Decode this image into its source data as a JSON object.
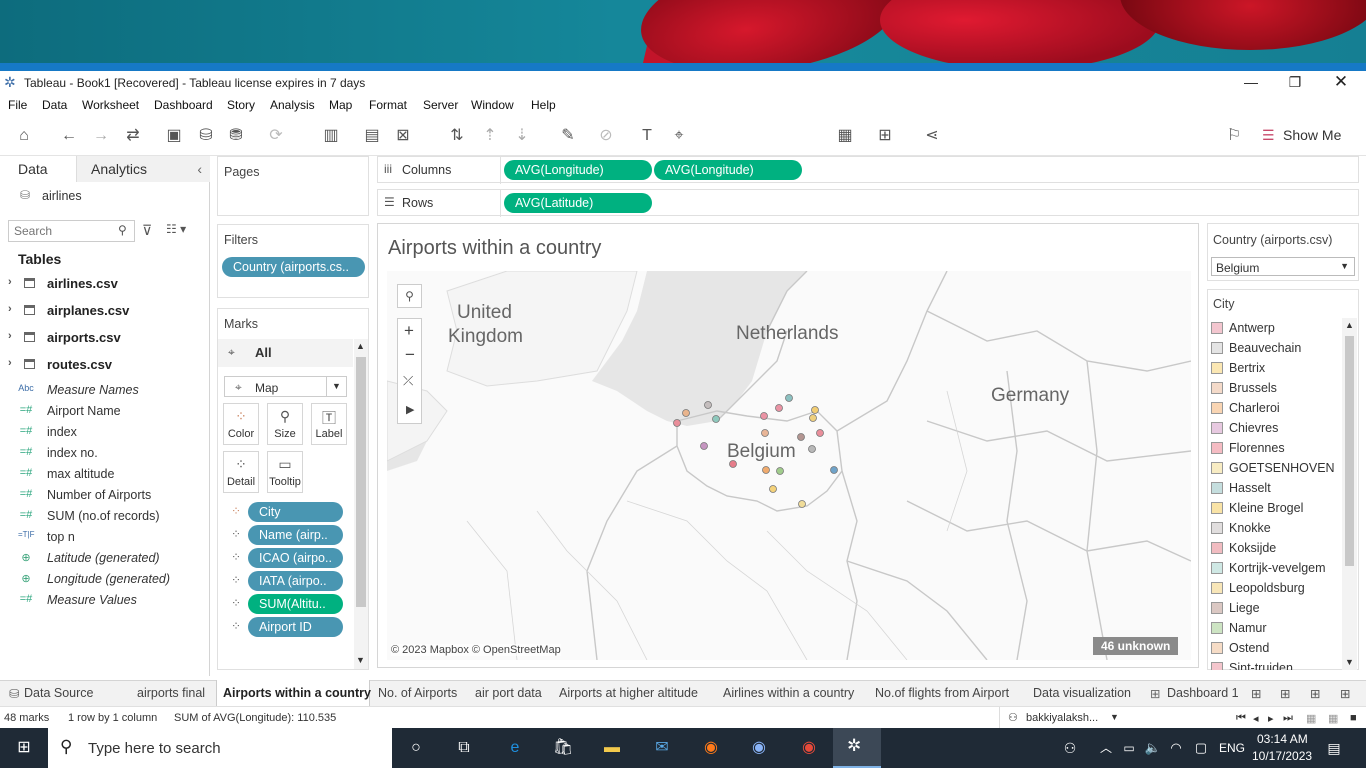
{
  "window": {
    "title": "Tableau - Book1 [Recovered] - Tableau license expires in 7 days"
  },
  "menu": [
    "File",
    "Data",
    "Worksheet",
    "Dashboard",
    "Story",
    "Analysis",
    "Map",
    "Format",
    "Server",
    "Window",
    "Help"
  ],
  "toolbar": {
    "show_me": "Show Me"
  },
  "left_panel": {
    "tab_data": "Data",
    "tab_analytics": "Analytics",
    "datasource": "airlines",
    "search_placeholder": "Search",
    "tables_heading": "Tables",
    "tables": [
      "airlines.csv",
      "airplanes.csv",
      "airports.csv",
      "routes.csv"
    ],
    "fields": [
      {
        "icon": "Abc",
        "label": "Measure Names",
        "italic": true
      },
      {
        "icon": "#",
        "label": "Airport Name",
        "italic": false
      },
      {
        "icon": "#",
        "label": "index",
        "italic": false
      },
      {
        "icon": "#",
        "label": "index no.",
        "italic": false
      },
      {
        "icon": "#",
        "label": "max altitude",
        "italic": false
      },
      {
        "icon": "#",
        "label": "Number of Airports",
        "italic": false
      },
      {
        "icon": "#",
        "label": "SUM (no.of records)",
        "italic": false
      },
      {
        "icon": "T|F",
        "label": "top n",
        "italic": false
      },
      {
        "icon": "globe",
        "label": "Latitude (generated)",
        "italic": true
      },
      {
        "icon": "globe",
        "label": "Longitude (generated)",
        "italic": true
      },
      {
        "icon": "#",
        "label": "Measure Values",
        "italic": true
      }
    ]
  },
  "pages": {
    "title": "Pages"
  },
  "filters": {
    "title": "Filters",
    "pills": [
      "Country (airports.cs.."
    ]
  },
  "marks": {
    "title": "Marks",
    "all_label": "All",
    "mark_type": "Map",
    "cards": [
      "Color",
      "Size",
      "Label",
      "Detail",
      "Tooltip"
    ],
    "pills": [
      {
        "icon": "color",
        "label": "City",
        "color": "blue"
      },
      {
        "icon": "detail",
        "label": "Name (airp..",
        "color": "blue"
      },
      {
        "icon": "detail",
        "label": "ICAO (airpo..",
        "color": "blue"
      },
      {
        "icon": "detail",
        "label": "IATA (airpo..",
        "color": "blue"
      },
      {
        "icon": "detail",
        "label": "SUM(Altitu..",
        "color": "green"
      },
      {
        "icon": "detail",
        "label": "Airport ID",
        "color": "blue"
      }
    ]
  },
  "shelves": {
    "columns_label": "Columns",
    "columns": [
      "AVG(Longitude)",
      "AVG(Longitude)"
    ],
    "rows_label": "Rows",
    "rows": [
      "AVG(Latitude)"
    ]
  },
  "view": {
    "title": "Airports within a country",
    "map_labels": [
      "United",
      "Kingdom",
      "Netherlands",
      "Germany",
      "Belgium"
    ],
    "attribution": "© 2023 Mapbox © OpenStreetMap",
    "unknown_badge": "46 unknown"
  },
  "country_filter": {
    "title": "Country (airports.csv)",
    "value": "Belgium"
  },
  "city_legend": {
    "title": "City",
    "items": [
      {
        "label": "Antwerp",
        "color": "#f3c6cf"
      },
      {
        "label": "Beauvechain",
        "color": "#e4e4e4"
      },
      {
        "label": "Bertrix",
        "color": "#fbe7b3"
      },
      {
        "label": "Brussels",
        "color": "#f4dac9"
      },
      {
        "label": "Charleroi",
        "color": "#f9d5b3"
      },
      {
        "label": "Chievres",
        "color": "#e7c9e0"
      },
      {
        "label": "Florennes",
        "color": "#f5bcc3"
      },
      {
        "label": "GOETSENHOVEN",
        "color": "#f8ecc3"
      },
      {
        "label": "Hasselt",
        "color": "#c5dede"
      },
      {
        "label": "Kleine Brogel",
        "color": "#f9e3a6"
      },
      {
        "label": "Knokke",
        "color": "#e1dede"
      },
      {
        "label": "Koksijde",
        "color": "#f1bcc1"
      },
      {
        "label": "Kortrijk-vevelgem",
        "color": "#cfe8e4"
      },
      {
        "label": "Leopoldsburg",
        "color": "#f8e6b8"
      },
      {
        "label": "Liege",
        "color": "#dbc8c3"
      },
      {
        "label": "Namur",
        "color": "#cde4c3"
      },
      {
        "label": "Ostend",
        "color": "#f6dcc6"
      },
      {
        "label": "Sint-truiden",
        "color": "#f4c6cd"
      }
    ]
  },
  "sheet_tabs": [
    "Data Source",
    "airports final",
    "Airports within a country",
    "No. of Airports",
    "air port data",
    "Airports at higher altitude",
    "Airlines within a country",
    "No.of flights from Airport",
    "Data visualization",
    "Dashboard 1"
  ],
  "status": {
    "marks": "48 marks",
    "rows_cols": "1 row by 1 column",
    "sum": "SUM of AVG(Longitude): 110.535",
    "user": "bakkiyalaksh..."
  },
  "taskbar": {
    "search_placeholder": "Type here to search",
    "lang": "ENG",
    "time": "03:14 AM",
    "date": "10/17/2023"
  },
  "map_points": [
    {
      "city": "Koksijde",
      "color": "#e98e9a"
    },
    {
      "city": "Ostend",
      "color": "#e9b48c"
    },
    {
      "city": "Knokke",
      "color": "#c4bdbd"
    },
    {
      "city": "Kortrijk-vevelgem",
      "color": "#8fc9bd"
    },
    {
      "city": "Chievres",
      "color": "#c595c0"
    },
    {
      "city": "Antwerp",
      "color": "#ea93a4"
    },
    {
      "city": "Antwerp",
      "color": "#ea93a4"
    },
    {
      "city": "Hasselt",
      "color": "#8cc1c1"
    },
    {
      "city": "Kleine Brogel",
      "color": "#f2cd73"
    },
    {
      "city": "Namur",
      "color": "#a0cc8c"
    },
    {
      "city": "Brussels",
      "color": "#e8b597"
    },
    {
      "city": "Leopoldsburg",
      "color": "#efd07e"
    },
    {
      "city": "Sint-truiden",
      "color": "#e98e9a"
    },
    {
      "city": "Liege",
      "color": "#b39591"
    },
    {
      "city": "Charleroi",
      "color": "#f0ab6e"
    },
    {
      "city": "Florennes",
      "color": "#e67d8a"
    },
    {
      "city": "Bertrix",
      "color": "#f4d27a"
    },
    {
      "city": "GOETSENHOVEN",
      "color": "#f0dc99"
    },
    {
      "city": "Beauvechain",
      "color": "#b8b8b8"
    },
    {
      "city": "Brussels",
      "color": "#6fa3c9"
    }
  ]
}
